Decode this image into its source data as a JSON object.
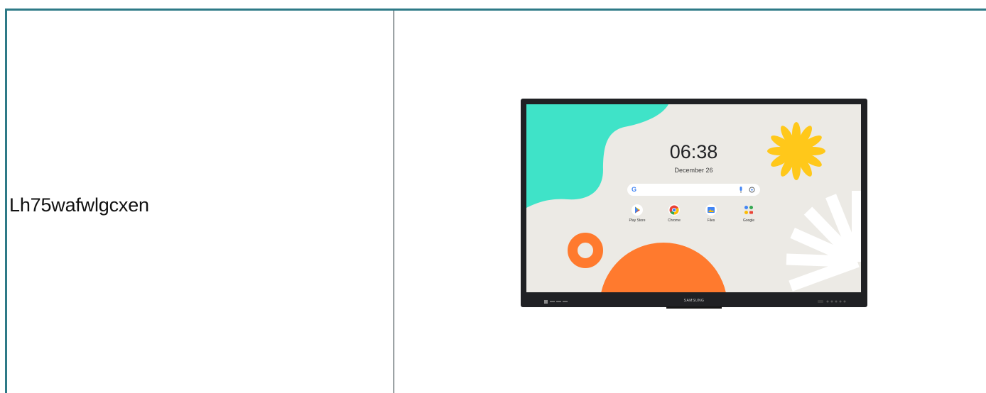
{
  "product": {
    "code": "Lh75wafwlgcxen"
  },
  "device": {
    "brand": "SAMSUNG",
    "screen": {
      "time": "06:38",
      "date": "December 26",
      "search": {
        "logo": "G"
      },
      "apps": [
        {
          "label": "Play Store"
        },
        {
          "label": "Chrome"
        },
        {
          "label": "Files"
        },
        {
          "label": "Google"
        }
      ]
    }
  },
  "colors": {
    "border": "#2e7a87",
    "bezel": "#202124",
    "screen_bg": "#eceae5",
    "teal_blob": "#3fe3c8",
    "flower": "#ffc81a",
    "orange": "#ff7a2e"
  }
}
